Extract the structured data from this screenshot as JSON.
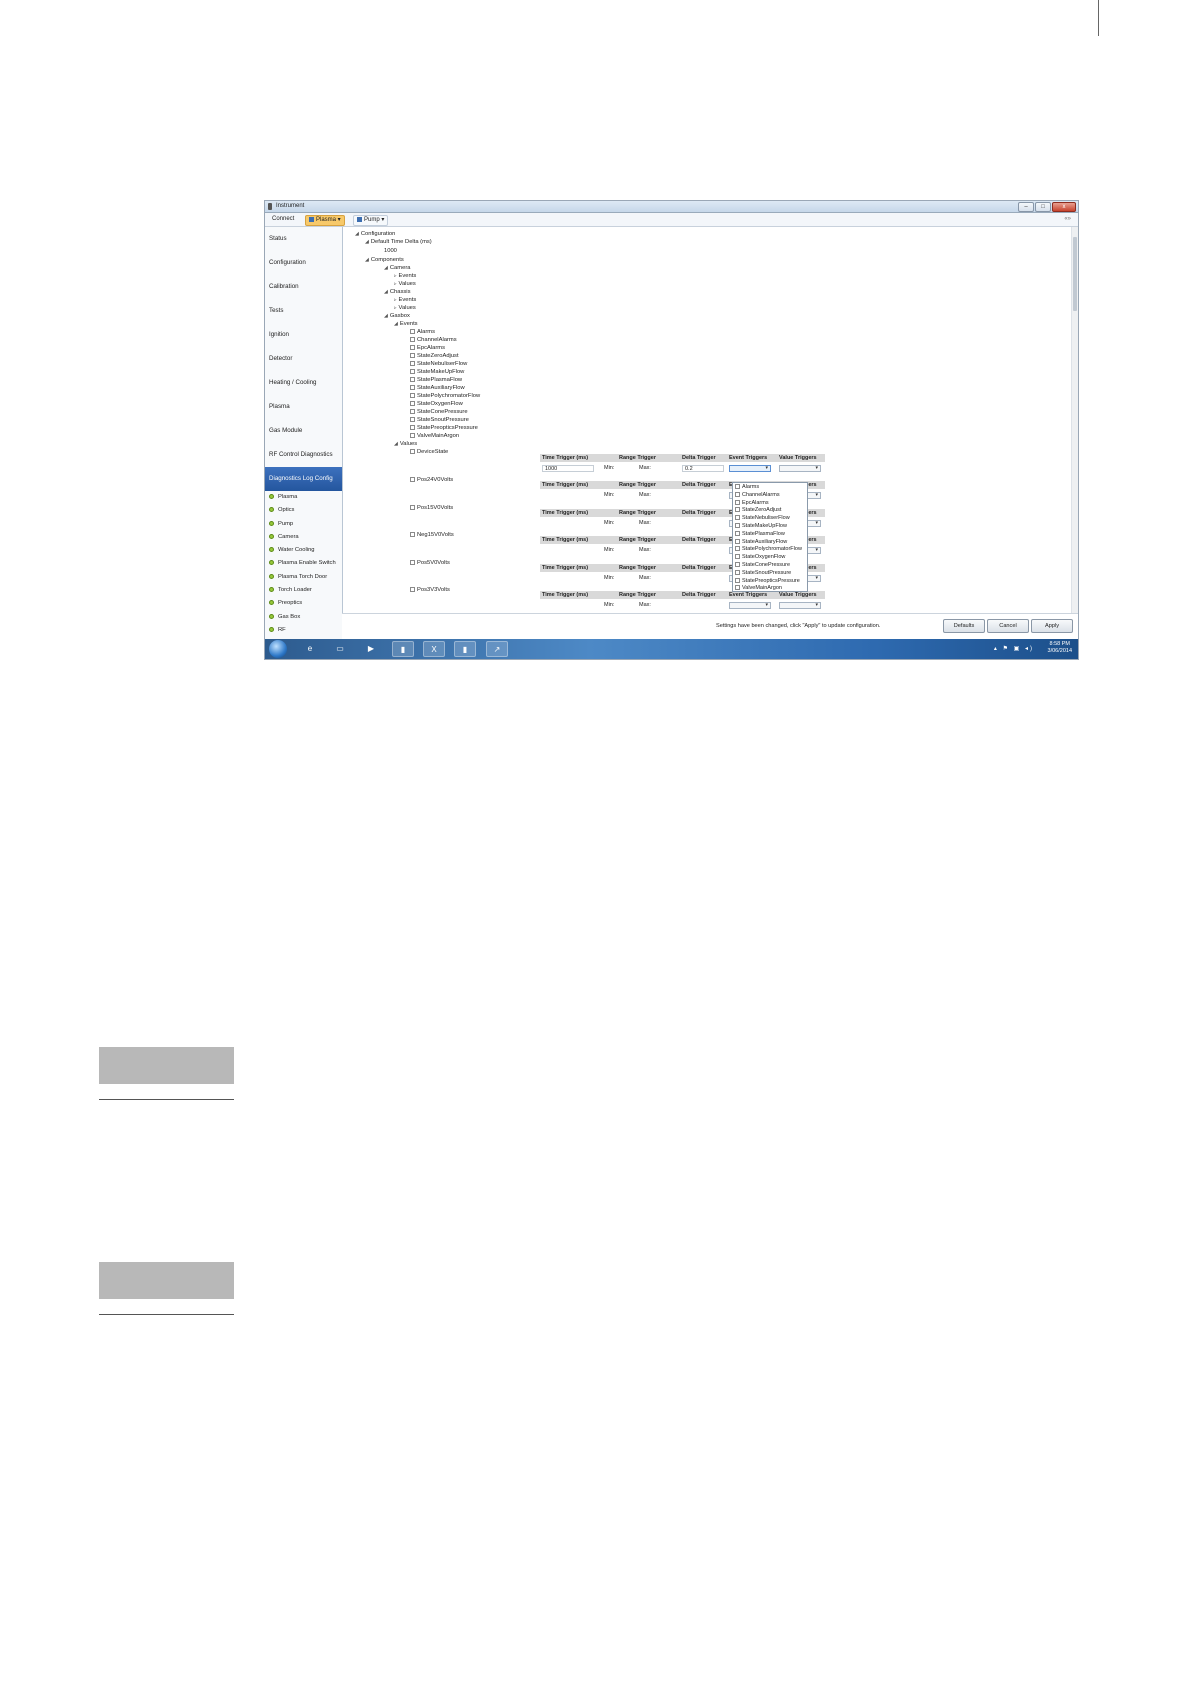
{
  "window": {
    "title": "Instrument",
    "buttons": {
      "minimize": "–",
      "maximize": "□",
      "close": "x"
    }
  },
  "toolbar": {
    "connect": "Connect",
    "plasma": "Plasma ▾",
    "pump": "Pump ▾",
    "collapse": "«»"
  },
  "sidebar": {
    "items": [
      "Status",
      "Configuration",
      "Calibration",
      "Tests",
      "Ignition",
      "Detector",
      "Heating / Cooling",
      "Plasma",
      "Gas Module",
      "RF Control Diagnostics",
      "Diagnostics Log Config"
    ],
    "subitems": [
      "Plasma",
      "Optics",
      "Pump",
      "Camera",
      "Water Cooling",
      "Plasma Enable Switch",
      "Plasma Torch Door",
      "Torch Loader",
      "Preoptics",
      "Gas Box",
      "RF"
    ]
  },
  "tree": {
    "configuration": "Configuration",
    "default_time_delta": "Default Time Delta (ms)",
    "default_time_delta_value": "1000",
    "components": "Components",
    "camera": "Camera",
    "events": "Events",
    "values": "Values",
    "chassis": "Chassis",
    "gasbox": "Gasbox",
    "gasbox_events": [
      "Alarms",
      "ChannelAlarms",
      "EpcAlarms",
      "StateZeroAdjust",
      "StateNebuliserFlow",
      "StateMakeUpFlow",
      "StatePlasmaFlow",
      "StateAuxiliaryFlow",
      "StatePolychromatorFlow",
      "StateOxygenFlow",
      "StateConePressure",
      "StateSnoutPressure",
      "StatePreopticsPressure",
      "ValveMainArgon"
    ],
    "gasbox_values": [
      "DeviceState",
      "Pos24V0Volts",
      "Pos15V0Volts",
      "Neg15V0Volts",
      "Pos5V0Volts",
      "Pos3V3Volts"
    ]
  },
  "param_table": {
    "headers": [
      "Time Trigger (ms)",
      "Range Trigger",
      "Delta Trigger",
      "Event Triggers",
      "Value Triggers"
    ],
    "min_label": "Min:",
    "max_label": "Max:",
    "first_row": {
      "time_trigger": "1000",
      "delta_trigger": "0.2"
    }
  },
  "event_dropdown_options": [
    "Alarms",
    "ChannelAlarms",
    "EpcAlarms",
    "StateZeroAdjust",
    "StateNebuliserFlow",
    "StateMakeUpFlow",
    "StatePlasmaFlow",
    "StateAuxiliaryFlow",
    "StatePolychromatorFlow",
    "StateOxygenFlow",
    "StateConePressure",
    "StateSnoutPressure",
    "StatePreopticsPressure",
    "ValveMainArgon"
  ],
  "footer": {
    "message": "Settings have been changed, click \"Apply\" to update configuration.",
    "defaults": "Defaults",
    "cancel": "Cancel",
    "apply": "Apply"
  },
  "taskbar": {
    "time": "8:58 PM",
    "date": "3/06/2014",
    "tray": "▴ ⚑ ▣ ◂)"
  }
}
